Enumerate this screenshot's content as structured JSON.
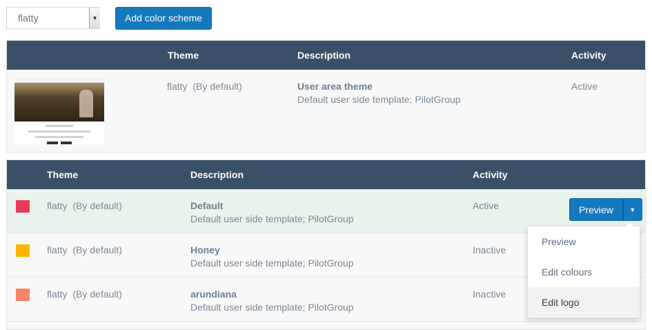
{
  "toolbar": {
    "theme_select_value": "flatty",
    "add_scheme_label": "Add color scheme"
  },
  "themes_table": {
    "headers": {
      "theme": "Theme",
      "description": "Description",
      "activity": "Activity"
    },
    "row": {
      "theme_name": "flatty",
      "theme_note": "(By default)",
      "desc_title": "User area theme",
      "desc_sub": "Default user side template; PilotGroup",
      "activity": "Active"
    }
  },
  "schemes_table": {
    "headers": {
      "theme": "Theme",
      "description": "Description",
      "activity": "Activity"
    },
    "rows": [
      {
        "color": "#ea3a5a",
        "theme_name": "flatty",
        "theme_note": "(By default)",
        "desc_title": "Default",
        "desc_sub": "Default user side template; PilotGroup",
        "activity": "Active"
      },
      {
        "color": "#ffb400",
        "theme_name": "flatty",
        "theme_note": "(By default)",
        "desc_title": "Honey",
        "desc_sub": "Default user side template; PilotGroup",
        "activity": "Inactive"
      },
      {
        "color": "#fb8466",
        "theme_name": "flatty",
        "theme_note": "(By default)",
        "desc_title": "arundiana",
        "desc_sub": "Default user side template; PilotGroup",
        "activity": "Inactive"
      }
    ],
    "preview_button": "Preview",
    "dropdown": [
      "Preview",
      "Edit colours",
      "Edit logo"
    ]
  },
  "colors": {
    "header_bg": "#3a5068",
    "primary": "#1479bf",
    "active_row": "#e9f3ec"
  },
  "icons": {
    "caret": "caret-down-icon",
    "select_arrow": "triangle-down-icon"
  }
}
